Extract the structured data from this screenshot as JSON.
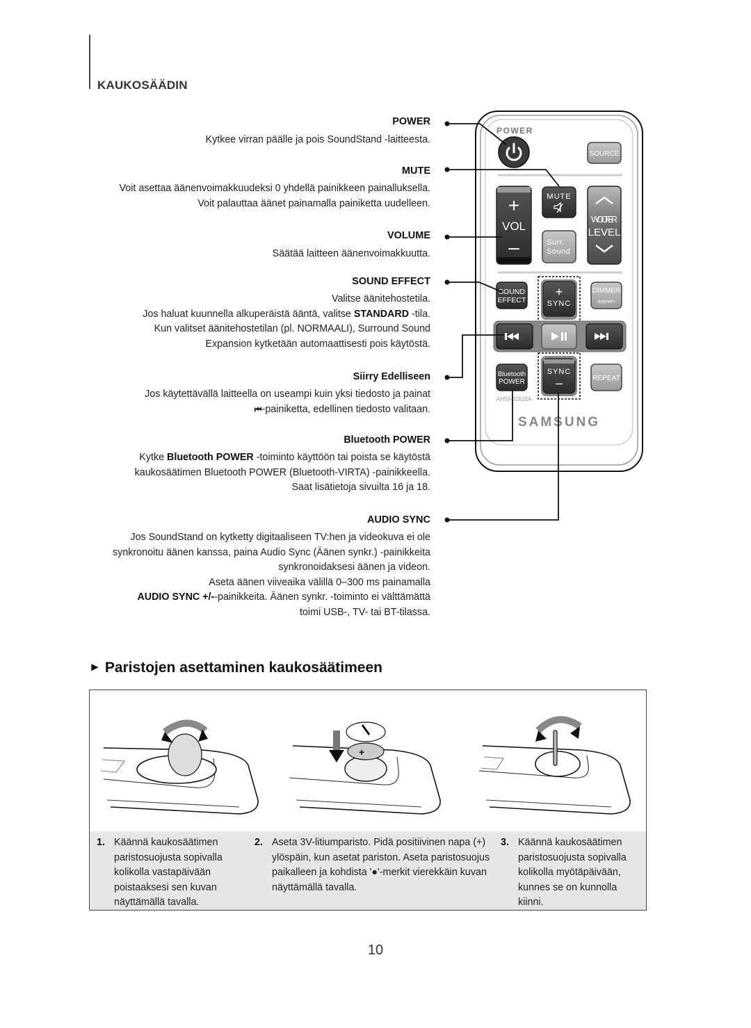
{
  "section_title": "KAUKOSÄÄDIN",
  "items": [
    {
      "heading": "POWER",
      "lines": [
        "Kytkee virran päälle ja pois SoundStand -laitteesta."
      ]
    },
    {
      "heading": "MUTE",
      "lines": [
        "Voit asettaa äänenvoimakkuudeksi 0 yhdellä painikkeen painalluksella.",
        "Voit palauttaa äänet painamalla painiketta uudelleen."
      ]
    },
    {
      "heading": "VOLUME",
      "lines": [
        "Säätää laitteen äänenvoimakkuutta."
      ]
    },
    {
      "heading": "SOUND EFFECT",
      "lines": [
        "Valitse äänitehostetila.",
        "Kun valitset äänitehostetilan (pl. NORMAALI), Surround Sound",
        "Expansion kytketään automaattisesti pois käytöstä."
      ],
      "rich_line": {
        "before": "Jos haluat kuunnella alkuperäistä ääntä, valitse ",
        "bold": "STANDARD",
        "after": " -tila."
      }
    },
    {
      "heading": "Siirry Edelliseen",
      "lines": [
        "Jos käytettävällä laitteella on useampi kuin yksi tiedosto ja painat"
      ],
      "rich_line": {
        "icon": "⏮",
        "after": "-painiketta, edellinen tiedosto valitaan."
      }
    },
    {
      "heading": "Bluetooth POWER",
      "rich_line": {
        "before": "Kytke ",
        "bold": "Bluetooth POWER",
        "after": " -toiminto käyttöön tai poista se käytöstä"
      },
      "lines": [
        "kaukosäätimen Bluetooth POWER (Bluetooth-VIRTA) -painikkeella.",
        "Saat lisätietoja sivuilta 16 ja 18."
      ]
    },
    {
      "heading": "AUDIO SYNC",
      "lines": [
        "Jos SoundStand on kytketty digitaaliseen TV:hen ja videokuva ei ole",
        "synkronoitu äänen kanssa, paina Audio Sync (Äänen synkr.) -painikkeita",
        "synkronoidaksesi äänen ja videon.",
        "Aseta äänen viiveaika välillä 0–300 ms painamalla",
        "toimi USB-, TV- tai BT-tilassa."
      ],
      "rich_line": {
        "bold": "AUDIO SYNC +/-",
        "after": "-painikkeita. Äänen synkr. -toiminto ei välttämättä"
      }
    }
  ],
  "remote": {
    "power_label": "POWER",
    "source": "SOURCE",
    "mute": "MUTE",
    "vol_plus": "+",
    "vol": "VOL",
    "vol_minus": "–",
    "surr1": "Surr.",
    "surr2": "Sound",
    "woofer1": "WOOFER",
    "woofer2": "LEVEL",
    "sound_effect1": "SOUND",
    "sound_effect2": "EFFECT",
    "sync": "SYNC",
    "sync_plus": "+",
    "sync_minus": "–",
    "dimmer": "DIMMER",
    "dimmer_sub": "Anynet+",
    "bt1": "Bluetooth",
    "bt2": "POWER",
    "repeat": "REPEAT",
    "model": "AH59-02615A",
    "brand": "SAMSUNG"
  },
  "battery": {
    "title": "Paristojen asettaminen kaukosäätimeen",
    "steps": [
      {
        "num": "1.",
        "text": "Käännä kaukosäätimen paristosuojusta sopivalla kolikolla vastapäivään poistaaksesi sen kuvan näyttämällä tavalla."
      },
      {
        "num": "2.",
        "text": "Aseta 3V-litiumparisto. Pidä positiivinen napa (+) ylöspäin, kun asetat pariston. Aseta paristosuojus paikalleen ja kohdista '●'-merkit vierekkäin kuvan näyttämällä tavalla."
      },
      {
        "num": "3.",
        "text": "Käännä kaukosäätimen paristosuojusta sopivalla kolikolla myötäpäivään, kunnes se on kunnolla kiinni."
      }
    ]
  },
  "page_number": "10"
}
